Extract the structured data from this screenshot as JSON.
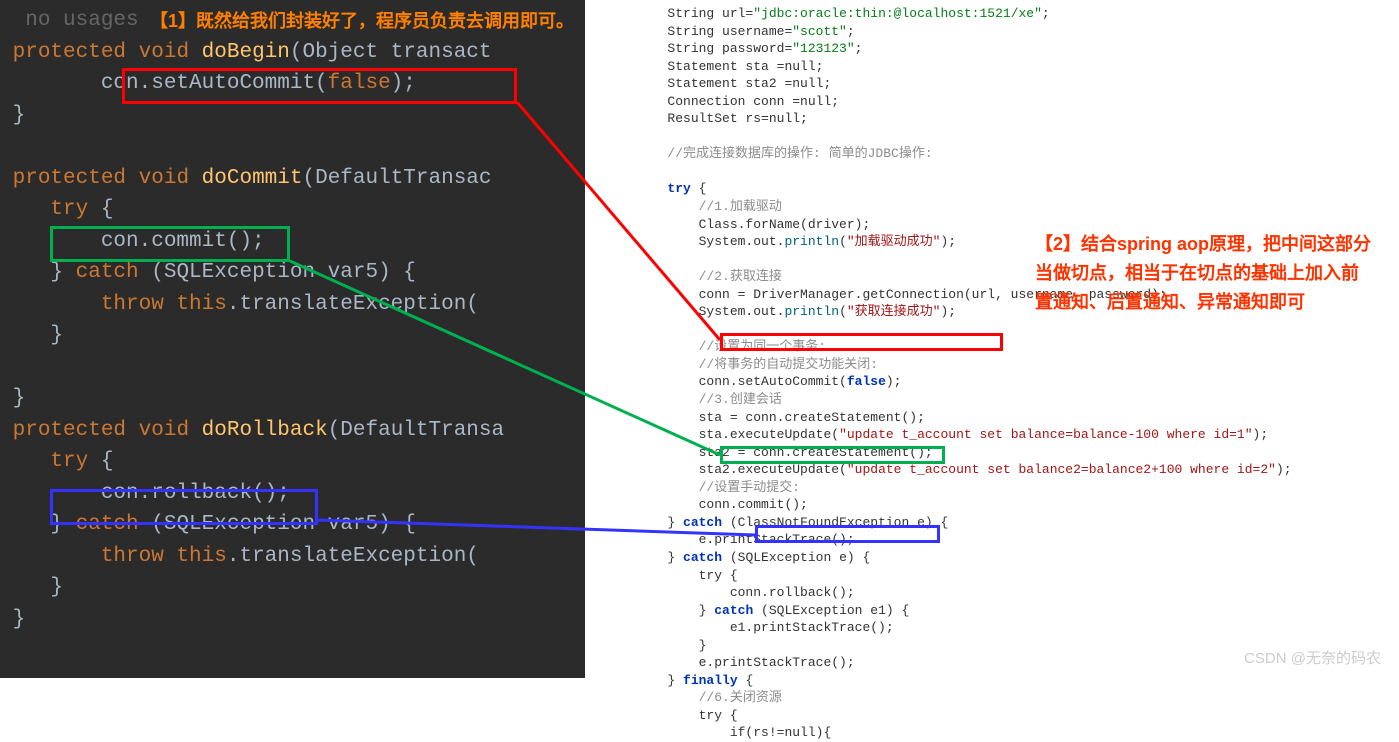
{
  "annotations": {
    "a1": "【1】既然给我们封装好了，程序员负责去调用即可。",
    "a2": "【2】结合spring aop原理，把中间这部分当做切点，相当于在切点的基础上加入前置通知、后置通知、异常通知即可"
  },
  "watermark": "CSDN @无奈的码农",
  "left": {
    "l0": "no usages",
    "l1a": "protected ",
    "l1b": "void ",
    "l1c": "doBegin",
    "l1d": "(Object transact",
    "l2": "        con.setAutoCommit(",
    "l2b": "false",
    "l2c": ");",
    "l3": "}",
    "l4a": "protected ",
    "l4b": "void ",
    "l4c": "doCommit",
    "l4d": "(DefaultTransac",
    "l5": "    try ",
    "l5b": "{",
    "l6": "        con.commit();",
    "l7": "    } ",
    "l7b": "catch ",
    "l7c": "(SQLException var5) {",
    "l8": "        throw ",
    "l8b": "this",
    "l8c": ".translateException(",
    "l9": "    }",
    "l10": "}",
    "l11a": "protected ",
    "l11b": "void ",
    "l11c": "doRollback",
    "l11d": "(DefaultTransa",
    "l12": "    try ",
    "l12b": "{",
    "l13": "        con.rollback();",
    "l14": "    } ",
    "l14b": "catch ",
    "l14c": "(SQLException var5) {",
    "l15": "        throw ",
    "l15b": "this",
    "l15c": ".translateException(",
    "l16": "    }",
    "l17": "}"
  },
  "right": {
    "r1a": "String url=",
    "r1b": "\"jdbc:oracle:thin:@localhost:1521/xe\"",
    "r1c": ";",
    "r2a": "String username=",
    "r2b": "\"scott\"",
    "r2c": ";",
    "r3a": "String password=",
    "r3b": "\"123123\"",
    "r3c": ";",
    "r4": "Statement sta =null;",
    "r5": "Statement sta2 =null;",
    "r6": "Connection conn =null;",
    "r7": "ResultSet rs=null;",
    "r8": "",
    "r9": "//完成连接数据库的操作: 简单的JDBC操作:",
    "r10": "",
    "r11a": "try",
    "r11b": " {",
    "r12": "    //1.加载驱动",
    "r13a": "    Class.forName(driver);",
    "r14a": "    System.out.",
    "r14b": "println",
    "r14c": "(",
    "r14d": "\"加载驱动成功\"",
    "r14e": ");",
    "r15": "",
    "r16": "    //2.获取连接",
    "r17": "    conn = DriverManager.getConnection(url, username, password);",
    "r18a": "    System.out.",
    "r18b": "println",
    "r18c": "(",
    "r18d": "\"获取连接成功\"",
    "r18e": ");",
    "r19": "",
    "r20": "    //设置为同一个事务:",
    "r21": "    //将事务的自动提交功能关闭:",
    "r22a": "    conn.setAutoCommit(",
    "r22b": "false",
    "r22c": ");",
    "r23": "    //3.创建会话",
    "r24": "    sta = conn.createStatement();",
    "r25a": "    sta.executeUpdate(",
    "r25b": "\"update t_account set balance=balance-100 where id=1\"",
    "r25c": ");",
    "r26": "    sta2 = conn.createStatement();",
    "r27a": "    sta2.executeUpdate(",
    "r27b": "\"update t_account set balance2=balance2+100 where id=2\"",
    "r27c": ");",
    "r28": "    //设置手动提交:",
    "r29": "    conn.commit();",
    "r30a": "} ",
    "r30b": "catch",
    "r30c": " (ClassNotFoundException e) {",
    "r31": "    e.printStackTrace();",
    "r32a": "} ",
    "r32b": "catch",
    "r32c": " (SQLException e) {",
    "r33": "    try {",
    "r34": "        conn.rollback();",
    "r35a": "    } ",
    "r35b": "catch",
    "r35c": " (SQLException e1) {",
    "r36": "        e1.printStackTrace();",
    "r37": "    }",
    "r38": "    e.printStackTrace();",
    "r39a": "} ",
    "r39b": "finally",
    "r39c": " {",
    "r40": "    //6.关闭资源",
    "r41": "    try {",
    "r42": "        if(rs!=null){"
  }
}
